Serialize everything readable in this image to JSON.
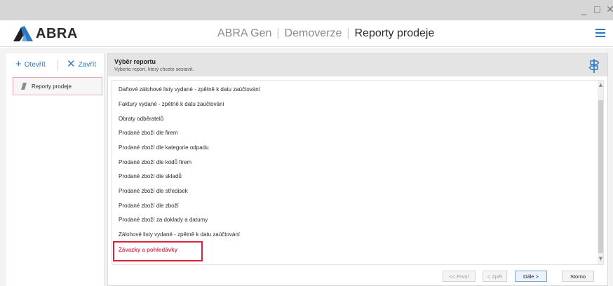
{
  "window": {
    "minimize_glyph": "_",
    "maximize_glyph": "☐",
    "close_glyph": "✕"
  },
  "header": {
    "logo_text": "ABRA",
    "breadcrumb": [
      "ABRA Gen",
      "Demoverze",
      "Reporty prodeje"
    ],
    "separator": "|",
    "menu_icon": "hamburger-icon",
    "accent_color": "#2b78c5"
  },
  "sidebar": {
    "open_label": "Otevřít",
    "close_label": "Zavřít",
    "open_icon": "plus-icon",
    "close_icon": "close-icon",
    "items": [
      {
        "label": "Reporty prodeje",
        "icon": "report-icon"
      }
    ]
  },
  "main": {
    "title": "Výběr reportu",
    "subtitle": "Vyberte report, který chcete sestavit.",
    "header_icon": "route-icon",
    "reports": [
      "Daňové zálohové listy vydané - zpětně k datu zaúčtování",
      "Faktury vydané - zpětně k datu zaúčtování",
      "Obraty odběratelů",
      "Prodané zboží dle firem",
      "Prodané zboží dle kategorie odpadu",
      "Prodané zboží dle kódů firem",
      "Prodané zboží dle skladů",
      "Prodané zboží dle středisek",
      "Prodané zboží dle zboží",
      "Prodané zboží za doklady a datumy",
      "Zálohové listy vydané - zpětně k datu zaúčtování",
      "Závazky a pohledávky"
    ],
    "selected_report": "Závazky a pohledávky",
    "selected_color": "#d8385a"
  },
  "footer": {
    "first_label": "<< První",
    "back_label": "< Zpět",
    "next_label": "Dále >",
    "cancel_label": "Storno"
  }
}
